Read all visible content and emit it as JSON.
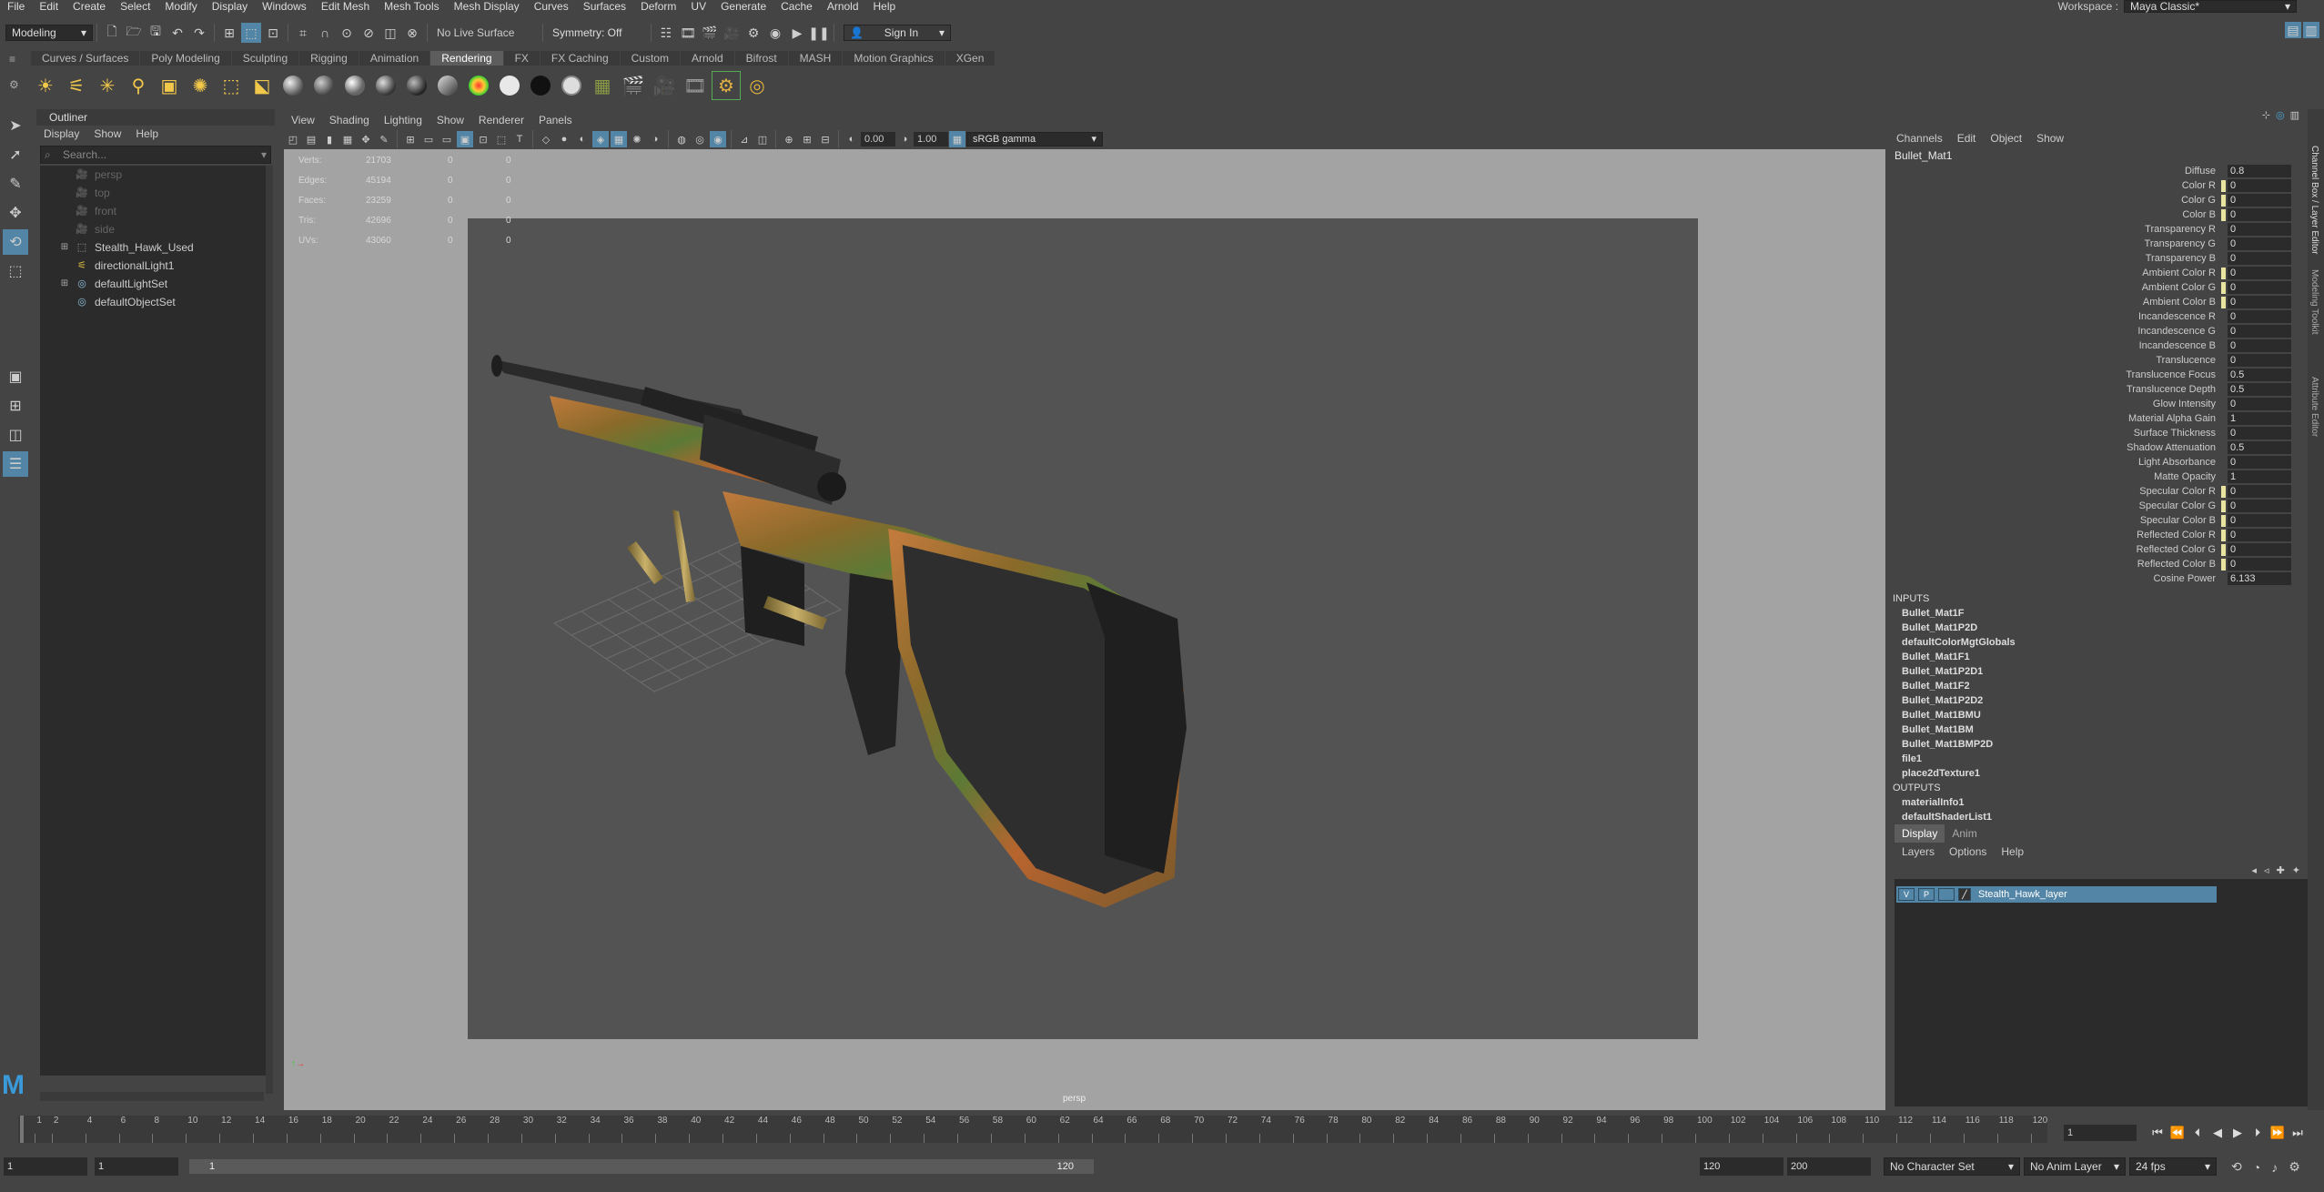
{
  "menubar": {
    "items": [
      "File",
      "Edit",
      "Create",
      "Select",
      "Modify",
      "Display",
      "Windows",
      "Edit Mesh",
      "Mesh Tools",
      "Mesh Display",
      "Curves",
      "Surfaces",
      "Deform",
      "UV",
      "Generate",
      "Cache",
      "Arnold",
      "Help"
    ],
    "workspace_label": "Workspace :",
    "workspace_value": "Maya Classic*"
  },
  "statusline": {
    "mode": "Modeling",
    "live_surface": "No Live Surface",
    "symmetry": "Symmetry: Off",
    "sign_in": "Sign In"
  },
  "shelf": {
    "tabs": [
      "Curves / Surfaces",
      "Poly Modeling",
      "Sculpting",
      "Rigging",
      "Animation",
      "Rendering",
      "FX",
      "FX Caching",
      "Custom",
      "Arnold",
      "Bifrost",
      "MASH",
      "Motion Graphics",
      "XGen"
    ],
    "active_tab": "Rendering"
  },
  "outliner": {
    "title": "Outliner",
    "menu": [
      "Display",
      "Show",
      "Help"
    ],
    "search_placeholder": "Search...",
    "items": [
      {
        "label": "persp",
        "icon": "camera-icon",
        "dim": true,
        "expandable": false
      },
      {
        "label": "top",
        "icon": "camera-icon",
        "dim": true,
        "expandable": false
      },
      {
        "label": "front",
        "icon": "camera-icon",
        "dim": true,
        "expandable": false
      },
      {
        "label": "side",
        "icon": "camera-icon",
        "dim": true,
        "expandable": false
      },
      {
        "label": "Stealth_Hawk_Used",
        "icon": "group-icon",
        "dim": false,
        "expandable": true
      },
      {
        "label": "directionalLight1",
        "icon": "directional-light-icon",
        "dim": false,
        "expandable": false
      },
      {
        "label": "defaultLightSet",
        "icon": "set-icon",
        "dim": false,
        "expandable": true
      },
      {
        "label": "defaultObjectSet",
        "icon": "set-icon",
        "dim": false,
        "expandable": false
      }
    ]
  },
  "viewport": {
    "menu": [
      "View",
      "Shading",
      "Lighting",
      "Show",
      "Renderer",
      "Panels"
    ],
    "exposure": "0.00",
    "gamma": "1.00",
    "color_space": "sRGB gamma",
    "camera": "persp",
    "hud": [
      {
        "label": "Verts:",
        "v1": "21703",
        "v2": "0",
        "v3": "0"
      },
      {
        "label": "Edges:",
        "v1": "45194",
        "v2": "0",
        "v3": "0"
      },
      {
        "label": "Faces:",
        "v1": "23259",
        "v2": "0",
        "v3": "0"
      },
      {
        "label": "Tris:",
        "v1": "42696",
        "v2": "0",
        "v3": "0"
      },
      {
        "label": "UVs:",
        "v1": "43060",
        "v2": "0",
        "v3": "0"
      }
    ]
  },
  "channelbox": {
    "menu": [
      "Channels",
      "Edit",
      "Object",
      "Show"
    ],
    "object": "Bullet_Mat1",
    "attributes": [
      {
        "name": "Diffuse",
        "value": "0.8",
        "swatch": ""
      },
      {
        "name": "Color R",
        "value": "0",
        "swatch": "#e8e4a0"
      },
      {
        "name": "Color G",
        "value": "0",
        "swatch": "#e8e4a0"
      },
      {
        "name": "Color B",
        "value": "0",
        "swatch": "#e8e4a0"
      },
      {
        "name": "Transparency R",
        "value": "0",
        "swatch": ""
      },
      {
        "name": "Transparency G",
        "value": "0",
        "swatch": ""
      },
      {
        "name": "Transparency B",
        "value": "0",
        "swatch": ""
      },
      {
        "name": "Ambient Color R",
        "value": "0",
        "swatch": "#e8e4a0"
      },
      {
        "name": "Ambient Color G",
        "value": "0",
        "swatch": "#e8e4a0"
      },
      {
        "name": "Ambient Color B",
        "value": "0",
        "swatch": "#e8e4a0"
      },
      {
        "name": "Incandescence R",
        "value": "0",
        "swatch": ""
      },
      {
        "name": "Incandescence G",
        "value": "0",
        "swatch": ""
      },
      {
        "name": "Incandescence B",
        "value": "0",
        "swatch": ""
      },
      {
        "name": "Translucence",
        "value": "0",
        "swatch": ""
      },
      {
        "name": "Translucence Focus",
        "value": "0.5",
        "swatch": ""
      },
      {
        "name": "Translucence Depth",
        "value": "0.5",
        "swatch": ""
      },
      {
        "name": "Glow Intensity",
        "value": "0",
        "swatch": ""
      },
      {
        "name": "Material Alpha Gain",
        "value": "1",
        "swatch": ""
      },
      {
        "name": "Surface Thickness",
        "value": "0",
        "swatch": ""
      },
      {
        "name": "Shadow Attenuation",
        "value": "0.5",
        "swatch": ""
      },
      {
        "name": "Light Absorbance",
        "value": "0",
        "swatch": ""
      },
      {
        "name": "Matte Opacity",
        "value": "1",
        "swatch": ""
      },
      {
        "name": "Specular Color R",
        "value": "0",
        "swatch": "#e8e4a0"
      },
      {
        "name": "Specular Color G",
        "value": "0",
        "swatch": "#e8e4a0"
      },
      {
        "name": "Specular Color B",
        "value": "0",
        "swatch": "#e8e4a0"
      },
      {
        "name": "Reflected Color R",
        "value": "0",
        "swatch": "#e8e4a0"
      },
      {
        "name": "Reflected Color G",
        "value": "0",
        "swatch": "#e8e4a0"
      },
      {
        "name": "Reflected Color B",
        "value": "0",
        "swatch": "#e8e4a0"
      },
      {
        "name": "Cosine Power",
        "value": "6.133",
        "swatch": ""
      }
    ],
    "inputs_label": "INPUTS",
    "inputs": [
      "Bullet_Mat1F",
      "Bullet_Mat1P2D",
      "defaultColorMgtGlobals",
      "Bullet_Mat1F1",
      "Bullet_Mat1P2D1",
      "Bullet_Mat1F2",
      "Bullet_Mat1P2D2",
      "Bullet_Mat1BMU",
      "Bullet_Mat1BM",
      "Bullet_Mat1BMP2D",
      "file1",
      "place2dTexture1"
    ],
    "outputs_label": "OUTPUTS",
    "outputs": [
      "materialInfo1",
      "defaultShaderList1"
    ]
  },
  "layers": {
    "tabs": [
      "Display",
      "Anim"
    ],
    "active_tab": "Display",
    "menu": [
      "Layers",
      "Options",
      "Help"
    ],
    "layer_name": "Stealth_Hawk_layer",
    "v": "V",
    "p": "P"
  },
  "sidetabs": [
    "Channel Box / Layer Editor",
    "Modeling Toolkit",
    "Attribute Editor"
  ],
  "timeline": {
    "ticks": [
      "1",
      "2",
      "4",
      "6",
      "8",
      "10",
      "12",
      "14",
      "16",
      "18",
      "20",
      "22",
      "24",
      "26",
      "28",
      "30",
      "32",
      "34",
      "36",
      "38",
      "40",
      "42",
      "44",
      "46",
      "48",
      "50",
      "52",
      "54",
      "56",
      "58",
      "60",
      "62",
      "64",
      "66",
      "68",
      "70",
      "72",
      "74",
      "76",
      "78",
      "80",
      "82",
      "84",
      "86",
      "88",
      "90",
      "92",
      "94",
      "96",
      "98",
      "100",
      "102",
      "104",
      "106",
      "108",
      "110",
      "112",
      "114",
      "116",
      "118",
      "120"
    ],
    "current_frame": "1"
  },
  "range": {
    "start": "1",
    "playback_start": "1",
    "bar_start": "1",
    "bar_end": "120",
    "playback_end": "120",
    "end": "200",
    "character_set": "No Character Set",
    "anim_layer": "No Anim Layer",
    "fps": "24 fps"
  },
  "colors": {
    "accent": "#5285a6",
    "panel": "#444444",
    "field": "#2b2b2b",
    "viewport_bg": "#a3a3a3"
  }
}
